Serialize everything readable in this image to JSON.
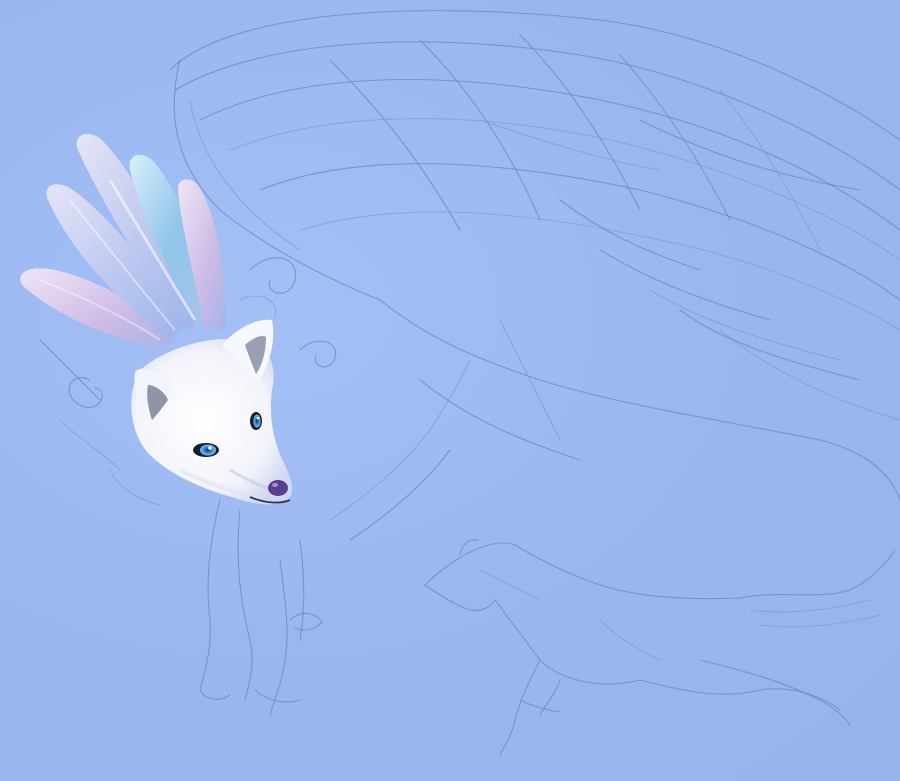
{
  "artwork": {
    "background_color": "#9bb8f2",
    "sketch_color": "#6f86c6",
    "fox_fur_color": "#f4f6fc",
    "feather_colors": [
      "#c9d3f5",
      "#9fc3ee",
      "#d6c4ea",
      "#b9c6f0"
    ],
    "eye_color": "#2a7fd6",
    "nose_color": "#5b3f8f",
    "subjects": [
      "painted-fox-head-with-feather-crest",
      "winged-creature-sketch",
      "running-wolf-sketch"
    ]
  }
}
